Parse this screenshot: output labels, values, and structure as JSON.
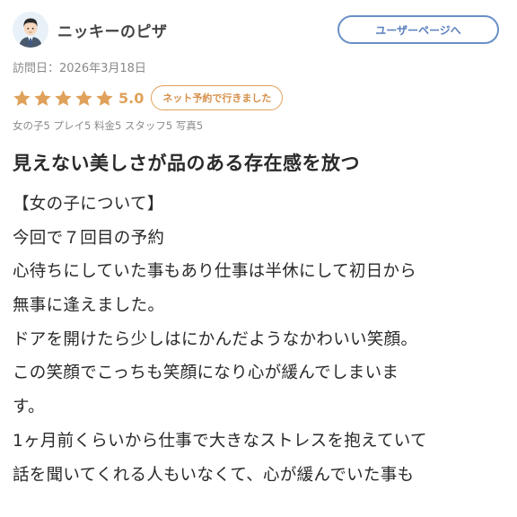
{
  "user": {
    "name": "ニッキーのピザ",
    "avatar_icon": "user-avatar-icon"
  },
  "user_page_button_label": "ユーザーページへ",
  "visit_date": "訪問日：2026年3月18日",
  "rating": {
    "score": "5.0",
    "stars": 5,
    "star_color": "#e0a15a",
    "booking_badge": "ネット予約で行きました",
    "sub_scores": "女の子5 プレイ5 料金5 スタッフ5 写真5"
  },
  "review": {
    "title": "見えない美しさが品のある存在感を放つ",
    "lines": [
      "【女の子について】",
      "今回で７回目の予約",
      "心待ちにしていた事もあり仕事は半休にして初日から",
      "無事に逢えました。",
      "ドアを開けたら少しはにかんだようなかわいい笑顔。",
      "この笑顔でこっちも笑顔になり心が緩んでしまいま",
      "す。",
      "1ヶ月前くらいから仕事で大きなストレスを抱えていて",
      "話を聞いてくれる人もいなくて、心が緩んでいた事も"
    ]
  },
  "colors": {
    "accent_blue": "#6a8fc7",
    "accent_orange": "#e0a15a"
  }
}
